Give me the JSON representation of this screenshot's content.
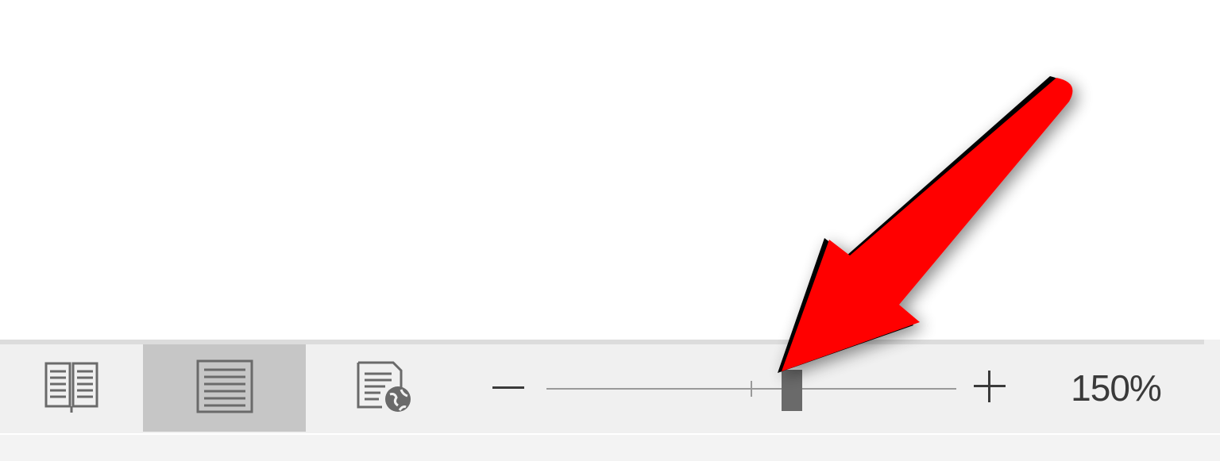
{
  "status_bar": {
    "views": [
      {
        "name": "read-mode",
        "icon": "read-mode-icon",
        "active": false
      },
      {
        "name": "print-layout",
        "icon": "print-layout-icon",
        "active": true
      },
      {
        "name": "web-layout",
        "icon": "web-layout-icon",
        "active": false
      }
    ],
    "zoom": {
      "minus_label": "−",
      "plus_label": "+",
      "level_text": "150%",
      "value_percent": 150,
      "min_percent": 10,
      "max_percent": 500
    }
  },
  "annotation": {
    "type": "arrow",
    "points_to": "zoom-slider-thumb",
    "color": "#ff0000"
  },
  "colors": {
    "status_bar_bg": "#f0f0f0",
    "active_view_bg": "#c6c6c6",
    "icon_gray": "#6a6a6a",
    "arrow_red": "#ff0000"
  }
}
